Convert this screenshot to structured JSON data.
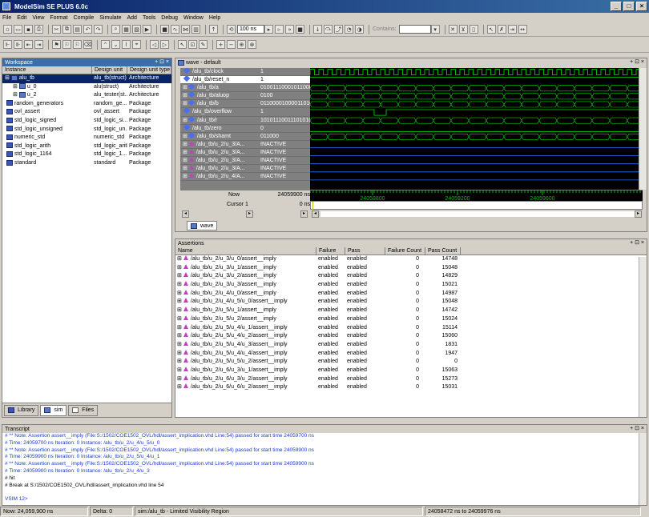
{
  "window": {
    "title": "ModelSim SE PLUS 6.0c"
  },
  "menu": [
    "File",
    "Edit",
    "View",
    "Format",
    "Compile",
    "Simulate",
    "Add",
    "Tools",
    "Debug",
    "Window",
    "Help"
  ],
  "toolbar": {
    "run_length": "100 ns",
    "contains_label": "Contains:"
  },
  "workspace": {
    "title": "Workspace",
    "columns": [
      "Instance",
      "Design unit",
      "Design unit type"
    ],
    "rows": [
      {
        "instance": "alu_tb",
        "unit": "alu_tb(struct)",
        "type": "Architecture",
        "level": 0,
        "icon": "instance-icon",
        "selected": true
      },
      {
        "instance": "u_0",
        "unit": "alu(struct)",
        "type": "Architecture",
        "level": 1,
        "icon": "instance-icon"
      },
      {
        "instance": "u_2",
        "unit": "alu_tester(st...",
        "type": "Architecture",
        "level": 1,
        "icon": "instance-icon"
      },
      {
        "instance": "random_generators",
        "unit": "random_ge...",
        "type": "Package",
        "level": 0,
        "icon": "package-icon"
      },
      {
        "instance": "ovl_assert",
        "unit": "ovl_assert",
        "type": "Package",
        "level": 0,
        "icon": "package-icon"
      },
      {
        "instance": "std_logic_signed",
        "unit": "std_logic_si...",
        "type": "Package",
        "level": 0,
        "icon": "package-icon"
      },
      {
        "instance": "std_logic_unsigned",
        "unit": "std_logic_un...",
        "type": "Package",
        "level": 0,
        "icon": "package-icon"
      },
      {
        "instance": "numeric_std",
        "unit": "numeric_std",
        "type": "Package",
        "level": 0,
        "icon": "package-icon"
      },
      {
        "instance": "std_logic_arith",
        "unit": "std_logic_arith",
        "type": "Package",
        "level": 0,
        "icon": "package-icon"
      },
      {
        "instance": "std_logic_1164",
        "unit": "std_logic_1...",
        "type": "Package",
        "level": 0,
        "icon": "package-icon"
      },
      {
        "instance": "standard",
        "unit": "standard",
        "type": "Package",
        "level": 0,
        "icon": "package-icon"
      }
    ],
    "tabs": [
      "Library",
      "sim",
      "Files"
    ]
  },
  "wave": {
    "title": "wave - default",
    "signals": [
      {
        "name": "/alu_tb/clock",
        "value": "1",
        "kind": "bit"
      },
      {
        "name": "/alu_tb/reset_n",
        "value": "1",
        "kind": "bit",
        "selected": true
      },
      {
        "name": "/alu_tb/a",
        "value": "010011100010110000",
        "kind": "bus"
      },
      {
        "name": "/alu_tb/aluop",
        "value": "0100",
        "kind": "bus"
      },
      {
        "name": "/alu_tb/b",
        "value": "011000010000110100",
        "kind": "bus"
      },
      {
        "name": "/alu_tb/overflow",
        "value": "1",
        "kind": "bit"
      },
      {
        "name": "/alu_tb/r",
        "value": "101011100111010100",
        "kind": "bus"
      },
      {
        "name": "/alu_tb/zero",
        "value": "0",
        "kind": "bit"
      },
      {
        "name": "/alu_tb/shamt",
        "value": "011000",
        "kind": "bus"
      },
      {
        "name": "/alu_tb/u_2/u_3/A...",
        "value": "INACTIVE",
        "kind": "assert"
      },
      {
        "name": "/alu_tb/u_2/u_3/A...",
        "value": "INACTIVE",
        "kind": "assert"
      },
      {
        "name": "/alu_tb/u_2/u_3/A...",
        "value": "INACTIVE",
        "kind": "assert"
      },
      {
        "name": "/alu_tb/u_2/u_3/A...",
        "value": "INACTIVE",
        "kind": "assert"
      },
      {
        "name": "/alu_tb/u_2/u_4/A...",
        "value": "INACTIVE",
        "kind": "assert"
      }
    ],
    "now_label": "Now",
    "now_value": "24059900 ns",
    "cursor_label": "Cursor 1",
    "cursor_value": "0 ns",
    "time_ticks": [
      "24058800",
      "24059200",
      "24059600"
    ],
    "tab": "wave"
  },
  "assertions": {
    "title": "Assertions",
    "columns": [
      "Name",
      "Failure",
      "Pass",
      "Failure Count",
      "Pass Count"
    ],
    "rows": [
      {
        "name": "/alu_tb/u_2/u_3/u_0/assert__imply",
        "failure": "enabled",
        "pass": "enabled",
        "fail_count": "0",
        "pass_count": "14748"
      },
      {
        "name": "/alu_tb/u_2/u_3/u_1/assert__imply",
        "failure": "enabled",
        "pass": "enabled",
        "fail_count": "0",
        "pass_count": "15048"
      },
      {
        "name": "/alu_tb/u_2/u_3/u_2/assert__imply",
        "failure": "enabled",
        "pass": "enabled",
        "fail_count": "0",
        "pass_count": "14829"
      },
      {
        "name": "/alu_tb/u_2/u_3/u_3/assert__imply",
        "failure": "enabled",
        "pass": "enabled",
        "fail_count": "0",
        "pass_count": "15021"
      },
      {
        "name": "/alu_tb/u_2/u_4/u_0/assert__imply",
        "failure": "enabled",
        "pass": "enabled",
        "fail_count": "0",
        "pass_count": "14987"
      },
      {
        "name": "/alu_tb/u_2/u_4/u_5/u_0/assert__imply",
        "failure": "enabled",
        "pass": "enabled",
        "fail_count": "0",
        "pass_count": "15048"
      },
      {
        "name": "/alu_tb/u_2/u_5/u_1/assert__imply",
        "failure": "enabled",
        "pass": "enabled",
        "fail_count": "0",
        "pass_count": "14742"
      },
      {
        "name": "/alu_tb/u_2/u_5/u_2/assert__imply",
        "failure": "enabled",
        "pass": "enabled",
        "fail_count": "0",
        "pass_count": "15024"
      },
      {
        "name": "/alu_tb/u_2/u_5/u_4/u_1/assert__imply",
        "failure": "enabled",
        "pass": "enabled",
        "fail_count": "0",
        "pass_count": "15114"
      },
      {
        "name": "/alu_tb/u_2/u_5/u_4/u_2/assert__imply",
        "failure": "enabled",
        "pass": "enabled",
        "fail_count": "0",
        "pass_count": "15060"
      },
      {
        "name": "/alu_tb/u_2/u_5/u_4/u_3/assert__imply",
        "failure": "enabled",
        "pass": "enabled",
        "fail_count": "0",
        "pass_count": "1831"
      },
      {
        "name": "/alu_tb/u_2/u_5/u_4/u_4/assert__imply",
        "failure": "enabled",
        "pass": "enabled",
        "fail_count": "0",
        "pass_count": "1947"
      },
      {
        "name": "/alu_tb/u_2/u_5/u_5/u_2/assert__imply",
        "failure": "enabled",
        "pass": "enabled",
        "fail_count": "0",
        "pass_count": "0"
      },
      {
        "name": "/alu_tb/u_2/u_6/u_3/u_1/assert__imply",
        "failure": "enabled",
        "pass": "enabled",
        "fail_count": "0",
        "pass_count": "15063"
      },
      {
        "name": "/alu_tb/u_2/u_6/u_3/u_2/assert__imply",
        "failure": "enabled",
        "pass": "enabled",
        "fail_count": "0",
        "pass_count": "15273"
      },
      {
        "name": "/alu_tb/u_2/u_6/u_6/u_2/assert__imply",
        "failure": "enabled",
        "pass": "enabled",
        "fail_count": "0",
        "pass_count": "15031"
      }
    ]
  },
  "transcript": {
    "title": "Transcript",
    "lines": [
      {
        "text": "# ** Note: Assertion assert__imply (File:S:/1502/COE1502_OVL/hdl/assert_implication.vhd Line:54) passed for start time 24059700 ns",
        "color": "blue"
      },
      {
        "text": "#    Time: 24059700 ns  Iteration: 0  Instance: /alu_tb/u_2/u_4/u_5/u_0",
        "color": "blue"
      },
      {
        "text": "# ** Note: Assertion assert__imply (File:S:/1502/COE1502_OVL/hdl/assert_implication.vhd Line:54) passed for start time 24059900 ns",
        "color": "blue"
      },
      {
        "text": "#    Time: 24059900 ns  Iteration: 0  Instance: /alu_tb/u_2/u_5/u_4/u_1",
        "color": "blue"
      },
      {
        "text": "# ** Note: Assertion assert__imply (File:S:/1502/COE1502_OVL/hdl/assert_implication.vhd Line:54) passed for start time 24059900 ns",
        "color": "blue"
      },
      {
        "text": "#    Time: 24059900 ns  Iteration: 0  Instance: /alu_tb/u_2/u_4/u_3",
        "color": "blue"
      },
      {
        "text": "# hit",
        "color": "black"
      },
      {
        "text": "# Break at S:/1502/COE1502_OVL/hdl/assert_implication.vhd line 54",
        "color": "black"
      },
      {
        "text": "",
        "color": "black"
      },
      {
        "text": "VSIM 12>",
        "color": "blue"
      }
    ]
  },
  "status": {
    "now": "Now: 24,059,900 ns",
    "delta": "Delta: 0",
    "region": "sim:/alu_tb - Limited Visibility Region",
    "range": "24058472 ns to 24059976 ns"
  }
}
